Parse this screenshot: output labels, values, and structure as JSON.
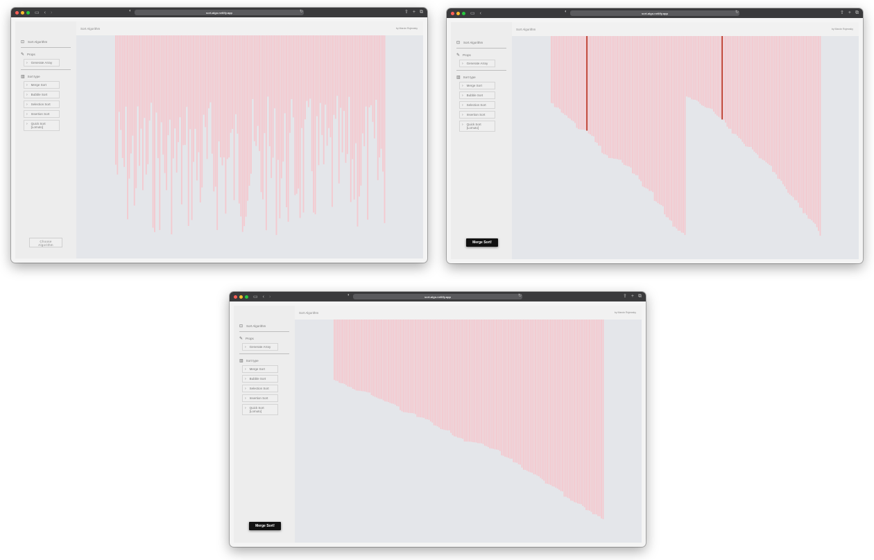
{
  "windows": [
    {
      "url": "sort-algo.netlify.app",
      "header": {
        "title": "Sort Algorithm",
        "author": "by Marcin Rojewsky"
      },
      "sidebar": {
        "brand": "Sort Algorithm",
        "props_label": "Props",
        "generate_label": "Generate Array",
        "sort_type_label": "Sort type",
        "algorithms": [
          "Merge Sort",
          "Bubble Sort",
          "Selection Sort",
          "Insertion Sort"
        ],
        "quick_sort_line1": "Quick Sort",
        "quick_sort_line2": "[Lomuto]"
      },
      "action": {
        "kind": "choose",
        "line1": "Choose",
        "line2": "Algorithm"
      },
      "visualization": {
        "state": "unsorted",
        "bar_color": "#f4c9cf",
        "highlight_color": "#c0392b"
      }
    },
    {
      "url": "sort-algo.netlify.app",
      "header": {
        "title": "Sort Algorithm",
        "author": "by Marcin Rojewsky"
      },
      "sidebar": {
        "brand": "Sort Algorithm",
        "props_label": "Props",
        "generate_label": "Generate Array",
        "sort_type_label": "Sort type",
        "algorithms": [
          "Merge Sort",
          "Bubble Sort",
          "Selection Sort",
          "Insertion Sort"
        ],
        "quick_sort_line1": "Quick Sort",
        "quick_sort_line2": "[Lomuto]"
      },
      "action": {
        "kind": "run",
        "label": "Merge Sort!"
      },
      "visualization": {
        "state": "two-sorted-halves",
        "bar_color": "#f4c9cf",
        "highlight_color": "#c0392b"
      }
    },
    {
      "url": "sort-algo.netlify.app",
      "header": {
        "title": "Sort Algorithm",
        "author": "by Marcin Rojewsky"
      },
      "sidebar": {
        "brand": "Sort Algorithm",
        "props_label": "Props",
        "generate_label": "Generate Array",
        "sort_type_label": "Sort type",
        "algorithms": [
          "Merge Sort",
          "Bubble Sort",
          "Selection Sort",
          "Insertion Sort"
        ],
        "quick_sort_line1": "Quick Sort",
        "quick_sort_line2": "[Lomuto]"
      },
      "action": {
        "kind": "run",
        "label": "Merge Sort!"
      },
      "visualization": {
        "state": "sorted",
        "bar_color": "#f4c9cf",
        "highlight_color": "#c0392b"
      }
    }
  ],
  "icons": {
    "brand": "bar-chart-box-icon",
    "props": "pencil-icon",
    "sort_type": "bar-chart-icon",
    "chevron": "chevron-right-icon"
  }
}
